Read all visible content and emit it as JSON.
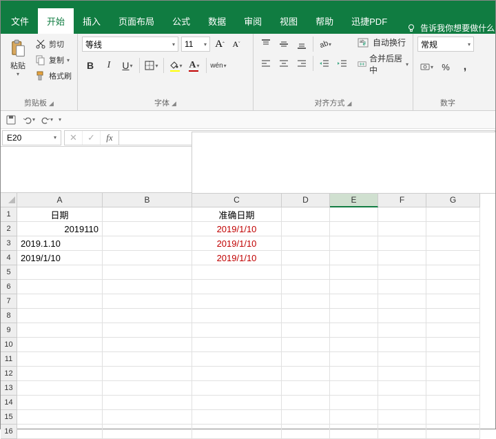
{
  "tabs": {
    "file": "文件",
    "home": "开始",
    "insert": "插入",
    "page_layout": "页面布局",
    "formulas": "公式",
    "data": "数据",
    "review": "审阅",
    "view": "视图",
    "help": "帮助",
    "pdf": "迅捷PDF"
  },
  "tell_me": "告诉我你想要做什么",
  "clipboard": {
    "paste": "粘贴",
    "cut": "剪切",
    "copy": "复制",
    "format_painter": "格式刷",
    "label": "剪贴板"
  },
  "font": {
    "name": "等线",
    "size": "11",
    "label": "字体",
    "bold": "B",
    "italic": "I",
    "underline": "U",
    "wen": "wén"
  },
  "align": {
    "wrap": "自动换行",
    "merge": "合并后居中",
    "label": "对齐方式"
  },
  "number": {
    "format": "常规",
    "label": "数字"
  },
  "namebox": "E20",
  "columns": [
    "A",
    "B",
    "C",
    "D",
    "E",
    "F",
    "G"
  ],
  "rows": [
    "1",
    "2",
    "3",
    "4",
    "5",
    "6",
    "7",
    "8",
    "9",
    "10",
    "11",
    "12",
    "13",
    "14",
    "15",
    "16"
  ],
  "cells": {
    "A1": "日期",
    "C1": "准确日期",
    "A2": "2019110",
    "A3": "2019.1.10",
    "A4": "2019/1/10",
    "C2": "2019/1/10",
    "C3": "2019/1/10",
    "C4": "2019/1/10"
  }
}
